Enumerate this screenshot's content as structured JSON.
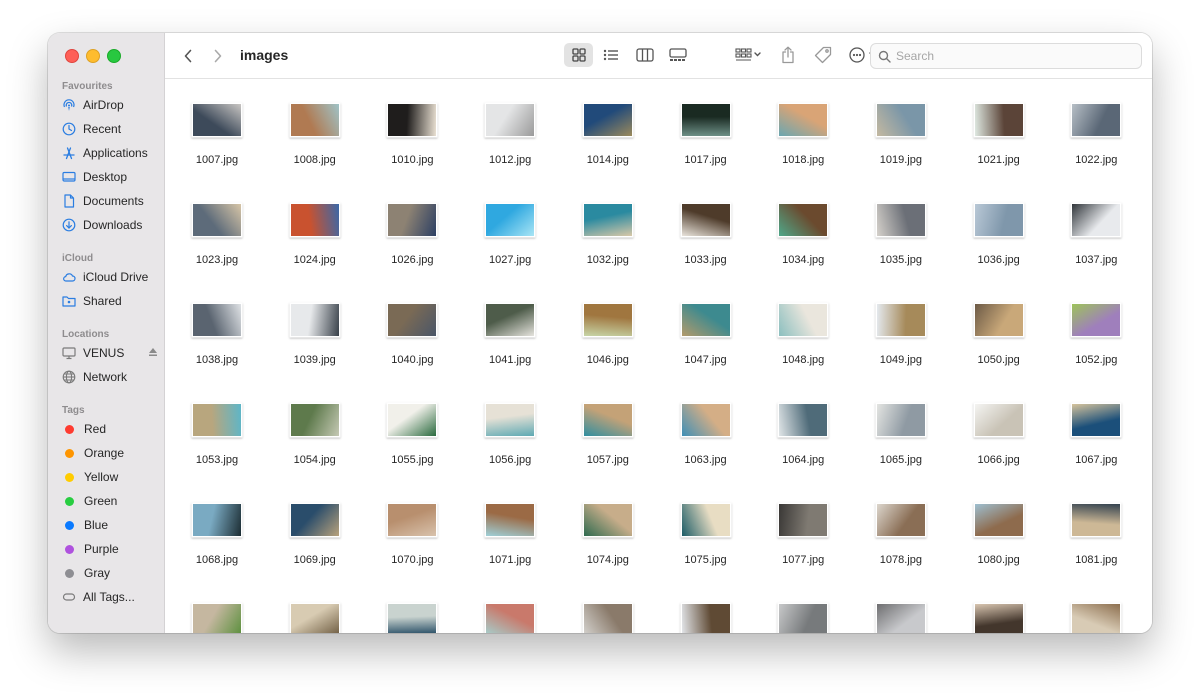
{
  "window": {
    "title": "images"
  },
  "sidebar": {
    "sections": [
      {
        "label": "Favourites",
        "items": [
          {
            "label": "AirDrop",
            "icon": "airdrop-icon"
          },
          {
            "label": "Recent",
            "icon": "clock-icon"
          },
          {
            "label": "Applications",
            "icon": "applications-icon"
          },
          {
            "label": "Desktop",
            "icon": "desktop-icon"
          },
          {
            "label": "Documents",
            "icon": "document-icon"
          },
          {
            "label": "Downloads",
            "icon": "download-icon"
          }
        ]
      },
      {
        "label": "iCloud",
        "items": [
          {
            "label": "iCloud Drive",
            "icon": "cloud-icon"
          },
          {
            "label": "Shared",
            "icon": "shared-folder-icon"
          }
        ]
      },
      {
        "label": "Locations",
        "items": [
          {
            "label": "VENUS",
            "icon": "computer-icon"
          },
          {
            "label": "Network",
            "icon": "globe-icon"
          }
        ]
      },
      {
        "label": "Tags",
        "items": [
          {
            "label": "Red",
            "color": "#fe3b30"
          },
          {
            "label": "Orange",
            "color": "#fe9500"
          },
          {
            "label": "Yellow",
            "color": "#ffcc00"
          },
          {
            "label": "Green",
            "color": "#28cd41"
          },
          {
            "label": "Blue",
            "color": "#0a7aff"
          },
          {
            "label": "Purple",
            "color": "#af52de"
          },
          {
            "label": "Gray",
            "color": "#8e8e93"
          },
          {
            "label": "All Tags...",
            "icon": "all-tags-icon"
          }
        ]
      }
    ]
  },
  "toolbar": {
    "back": "chevron-left-icon",
    "forward": "chevron-right-icon",
    "views": [
      "icon-view-icon",
      "list-view-icon",
      "column-view-icon",
      "gallery-view-icon"
    ],
    "group": "group-by-icon",
    "share": "share-icon",
    "tag": "tag-icon",
    "more": "ellipsis-icon",
    "search_placeholder": "Search"
  },
  "files": {
    "rows": [
      {
        "names": [
          "1007.jpg",
          "1008.jpg",
          "1010.jpg",
          "1012.jpg",
          "1014.jpg",
          "1017.jpg",
          "1018.jpg",
          "1019.jpg",
          "1021.jpg",
          "1022.jpg"
        ],
        "colors": [
          [
            "#3d4a5a",
            "#c9c6c3"
          ],
          [
            "#b07a52",
            "#9fc3c7"
          ],
          [
            "#1f1d1c",
            "#e9e0d2"
          ],
          [
            "#e4e5e6",
            "#9a9a9a"
          ],
          [
            "#214a7a",
            "#9b8a5c"
          ],
          [
            "#1a2a22",
            "#6d8f86"
          ],
          [
            "#d9a476",
            "#6aa6b1"
          ],
          [
            "#7a96a8",
            "#c4b9a1"
          ],
          [
            "#5b4438",
            "#dfe9e2"
          ],
          [
            "#5a6776",
            "#b7bfc6"
          ]
        ]
      },
      {
        "names": [
          "1023.jpg",
          "1024.jpg",
          "1026.jpg",
          "1027.jpg",
          "1032.jpg",
          "1033.jpg",
          "1034.jpg",
          "1035.jpg",
          "1036.jpg",
          "1037.jpg"
        ],
        "colors": [
          [
            "#5d6b7a",
            "#d7c5a7"
          ],
          [
            "#c9522f",
            "#3a68a8"
          ],
          [
            "#8d8273",
            "#2c3f63"
          ],
          [
            "#2fa8e0",
            "#a8e5f5"
          ],
          [
            "#2a8aa0",
            "#d8c8a8"
          ],
          [
            "#4e3b2a",
            "#e9e4dc"
          ],
          [
            "#6b4a2e",
            "#4fa88a"
          ],
          [
            "#6b6f77",
            "#d5d1cb"
          ],
          [
            "#7f97ab",
            "#b9c8d6"
          ],
          [
            "#e8eaed",
            "#30353a"
          ]
        ]
      },
      {
        "names": [
          "1038.jpg",
          "1039.jpg",
          "1040.jpg",
          "1041.jpg",
          "1046.jpg",
          "1047.jpg",
          "1048.jpg",
          "1049.jpg",
          "1050.jpg",
          "1052.jpg"
        ],
        "colors": [
          [
            "#5a6470",
            "#dfe2e5"
          ],
          [
            "#e7e9eb",
            "#39414a"
          ],
          [
            "#7a6a55",
            "#4a5668"
          ],
          [
            "#4e5c4a",
            "#e5e3dd"
          ],
          [
            "#a0763f",
            "#c7d5a7"
          ],
          [
            "#3d8a8f",
            "#b39a6b"
          ],
          [
            "#eae6dd",
            "#8bbfbf"
          ],
          [
            "#a68a5a",
            "#e4e9ee"
          ],
          [
            "#c9a879",
            "#6c5a46"
          ],
          [
            "#9f7fbc",
            "#9dc35a"
          ]
        ]
      },
      {
        "names": [
          "1053.jpg",
          "1054.jpg",
          "1055.jpg",
          "1056.jpg",
          "1057.jpg",
          "1063.jpg",
          "1064.jpg",
          "1065.jpg",
          "1066.jpg",
          "1067.jpg"
        ],
        "colors": [
          [
            "#b8a67e",
            "#5db6c8"
          ],
          [
            "#5e7a4c",
            "#c5c9b4"
          ],
          [
            "#f1f0ea",
            "#2a6a3e"
          ],
          [
            "#e6e1d6",
            "#5ea9b3"
          ],
          [
            "#c4a277",
            "#2f8ea0"
          ],
          [
            "#d4ae86",
            "#3f8fb6"
          ],
          [
            "#4f6b79",
            "#e0e5e7"
          ],
          [
            "#8f9aa3",
            "#e3e4e1"
          ],
          [
            "#c9c3b6",
            "#f4f4f2"
          ],
          [
            "#1b4f7a",
            "#d6c39c"
          ]
        ]
      },
      {
        "names": [
          "1068.jpg",
          "1069.jpg",
          "1070.jpg",
          "1071.jpg",
          "1074.jpg",
          "1075.jpg",
          "1077.jpg",
          "1078.jpg",
          "1080.jpg",
          "1081.jpg"
        ],
        "colors": [
          [
            "#7aaac2",
            "#1c2d33"
          ],
          [
            "#2a4d6b",
            "#b8a27c"
          ],
          [
            "#b88f6e",
            "#d8c2ac"
          ],
          [
            "#9b6a45",
            "#9fd0d8"
          ],
          [
            "#c7ad8a",
            "#2e6a4f"
          ],
          [
            "#e8ddc3",
            "#1c5c66"
          ],
          [
            "#7f7a72",
            "#3a3836"
          ],
          [
            "#8a6e55",
            "#dcd6cd"
          ],
          [
            "#8e6b4d",
            "#9ebfd0"
          ],
          [
            "#cdb896",
            "#33424f"
          ]
        ]
      },
      {
        "names": [
          "",
          "",
          "",
          "",
          "",
          "",
          "",
          "",
          "",
          ""
        ],
        "colors": [
          [
            "#c5b7a0",
            "#5a8f3c"
          ],
          [
            "#d8cbb2",
            "#6c5a3f"
          ],
          [
            "#c9d3cf",
            "#163f5a"
          ],
          [
            "#c9796b",
            "#a4d2d0"
          ],
          [
            "#8a7a6a",
            "#d5d3cf"
          ],
          [
            "#5f4a34",
            "#e3e6ea"
          ],
          [
            "#777a7c",
            "#c7c8c9"
          ],
          [
            "#c8c9cc",
            "#6e6e70"
          ],
          [
            "#43362c",
            "#d8c5b0"
          ],
          [
            "#d8cbb5",
            "#8d6f4f"
          ]
        ]
      }
    ]
  }
}
